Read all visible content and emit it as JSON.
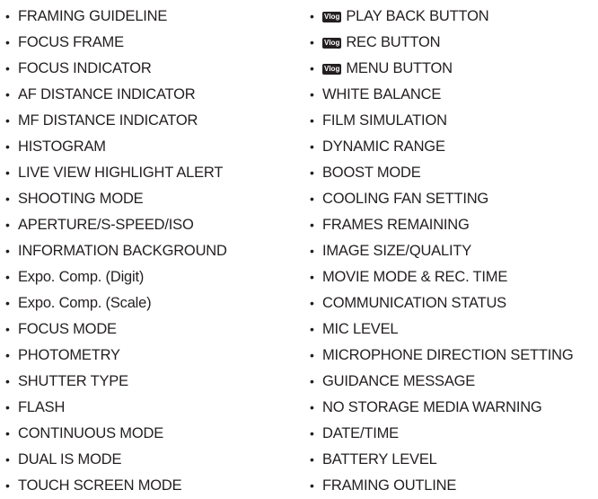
{
  "bullet": "•",
  "left_items": [
    "FRAMING GUIDELINE",
    "FOCUS FRAME",
    "FOCUS INDICATOR",
    "AF DISTANCE INDICATOR",
    "MF DISTANCE INDICATOR",
    "HISTOGRAM",
    "LIVE VIEW HIGHLIGHT ALERT",
    "SHOOTING MODE",
    "APERTURE/S-SPEED/ISO",
    "INFORMATION BACKGROUND",
    "Expo. Comp. (Digit)",
    "Expo. Comp. (Scale)",
    "FOCUS MODE",
    "PHOTOMETRY",
    "SHUTTER TYPE",
    "FLASH",
    "CONTINUOUS MODE",
    "DUAL IS MODE",
    "TOUCH SCREEN MODE"
  ],
  "right_items": [
    {
      "badge": "Vlog",
      "label": "PLAY BACK BUTTON"
    },
    {
      "badge": "Vlog",
      "label": "REC BUTTON"
    },
    {
      "badge": "Vlog",
      "label": "MENU BUTTON"
    },
    {
      "label": "WHITE BALANCE"
    },
    {
      "label": "FILM SIMULATION"
    },
    {
      "label": "DYNAMIC RANGE"
    },
    {
      "label": "BOOST MODE"
    },
    {
      "label": "COOLING FAN SETTING"
    },
    {
      "label": "FRAMES REMAINING"
    },
    {
      "label": "IMAGE SIZE/QUALITY"
    },
    {
      "label": "MOVIE MODE & REC. TIME"
    },
    {
      "label": "COMMUNICATION STATUS"
    },
    {
      "label": "MIC LEVEL"
    },
    {
      "label": "MICROPHONE DIRECTION SETTING"
    },
    {
      "label": "GUIDANCE MESSAGE"
    },
    {
      "label": "NO STORAGE MEDIA WARNING"
    },
    {
      "label": "DATE/TIME"
    },
    {
      "label": "BATTERY LEVEL"
    },
    {
      "label": "FRAMING OUTLINE"
    }
  ],
  "colors": {
    "text": "#231f20",
    "badge_bg": "#231f20",
    "background": "#ffffff"
  }
}
